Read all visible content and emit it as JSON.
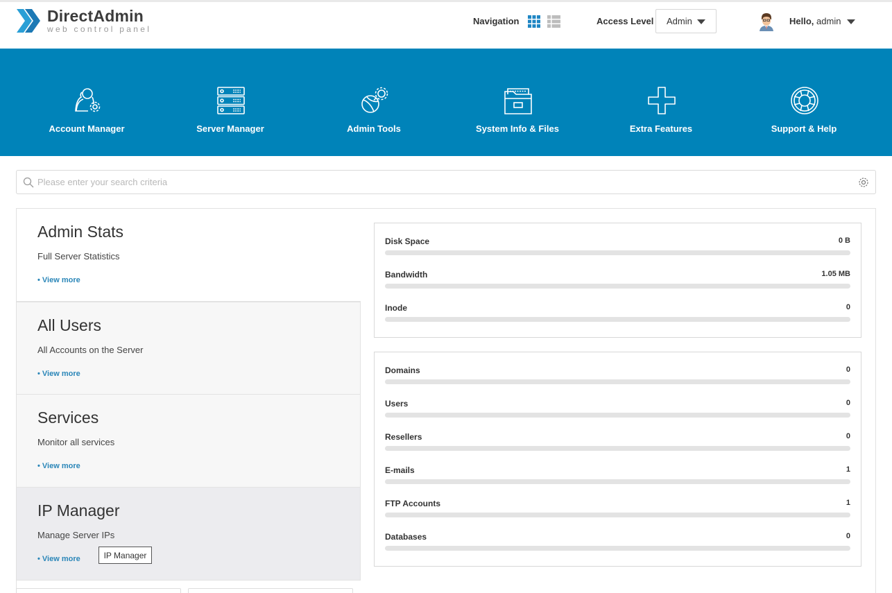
{
  "header": {
    "logo_title": "DirectAdmin",
    "logo_subtitle": "web control panel",
    "navigation_label": "Navigation",
    "access_level_label": "Access Level",
    "access_level_value": "Admin",
    "hello_prefix": "Hello,",
    "username": "admin"
  },
  "menu": [
    {
      "label": "Account Manager",
      "icon": "account-manager-icon"
    },
    {
      "label": "Server Manager",
      "icon": "server-manager-icon"
    },
    {
      "label": "Admin Tools",
      "icon": "admin-tools-icon"
    },
    {
      "label": "System Info & Files",
      "icon": "system-info-files-icon"
    },
    {
      "label": "Extra Features",
      "icon": "extra-features-icon"
    },
    {
      "label": "Support & Help",
      "icon": "support-help-icon"
    }
  ],
  "search": {
    "placeholder": "Please enter your search criteria"
  },
  "cards": [
    {
      "title": "Admin Stats",
      "desc": "Full Server Statistics",
      "link": "• View more"
    },
    {
      "title": "All Users",
      "desc": "All Accounts on the Server",
      "link": "• View more"
    },
    {
      "title": "Services",
      "desc": "Monitor all services",
      "link": "• View more"
    },
    {
      "title": "IP Manager",
      "desc": "Manage Server IPs",
      "link": "• View more"
    }
  ],
  "tooltip": "IP Manager",
  "usage_stats": [
    {
      "label": "Disk Space",
      "value": "0 B",
      "fill": 0
    },
    {
      "label": "Bandwidth",
      "value": "1.05 MB",
      "fill": 0
    },
    {
      "label": "Inode",
      "value": "0",
      "fill": 0
    }
  ],
  "count_stats": [
    {
      "label": "Domains",
      "value": "0",
      "fill": 0
    },
    {
      "label": "Users",
      "value": "0",
      "fill": 0
    },
    {
      "label": "Resellers",
      "value": "0",
      "fill": 0
    },
    {
      "label": "E-mails",
      "value": "1",
      "fill": 0
    },
    {
      "label": "FTP Accounts",
      "value": "1",
      "fill": 0
    },
    {
      "label": "Databases",
      "value": "0",
      "fill": 0
    }
  ],
  "colors": {
    "brand_blue": "#0083b9",
    "link_blue": "#2a86b8",
    "bar_track": "#e3e3e3"
  }
}
